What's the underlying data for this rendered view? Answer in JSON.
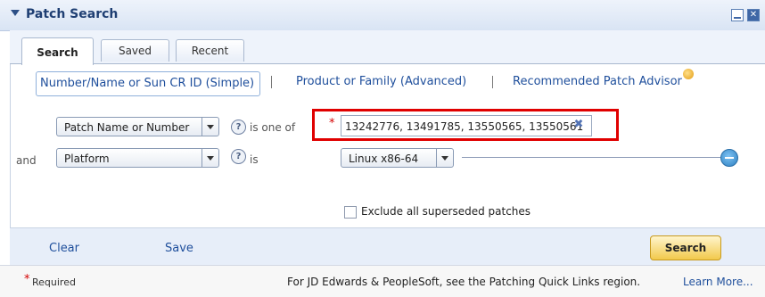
{
  "panel": {
    "title": "Patch Search"
  },
  "tabs": [
    {
      "label": "Search",
      "active": true
    },
    {
      "label": "Saved",
      "active": false
    },
    {
      "label": "Recent",
      "active": false
    }
  ],
  "modes": {
    "simple": "Number/Name or Sun CR ID (Simple)",
    "advanced": "Product or Family (Advanced)",
    "advisor": "Recommended Patch Advisor"
  },
  "criteria": {
    "row1": {
      "field": "Patch Name or Number",
      "operator": "is one of",
      "value": "13242776, 13491785, 13550565, 13550561",
      "required_mark": "*"
    },
    "row2": {
      "connector": "and",
      "field": "Platform",
      "operator": "is",
      "value": "Linux x86-64"
    }
  },
  "options": {
    "exclude_superseded": "Exclude all superseded patches",
    "exclude_checked": false
  },
  "actions": {
    "clear": "Clear",
    "save": "Save",
    "search": "Search"
  },
  "footer": {
    "required": "Required",
    "required_mark": "*",
    "note": "For JD Edwards & PeopleSoft, see the Patching Quick Links region.",
    "learn_more": "Learn More..."
  },
  "icons": {
    "collapse": "triangle-down-icon",
    "help": "help-icon",
    "clear_value": "clear-icon",
    "remove_row": "remove-row-icon",
    "advisor": "sun-icon"
  },
  "colors": {
    "accent": "#1f4f9c",
    "required": "#d40000",
    "highlight": "#e00000",
    "search_button": "#f2c94c"
  }
}
